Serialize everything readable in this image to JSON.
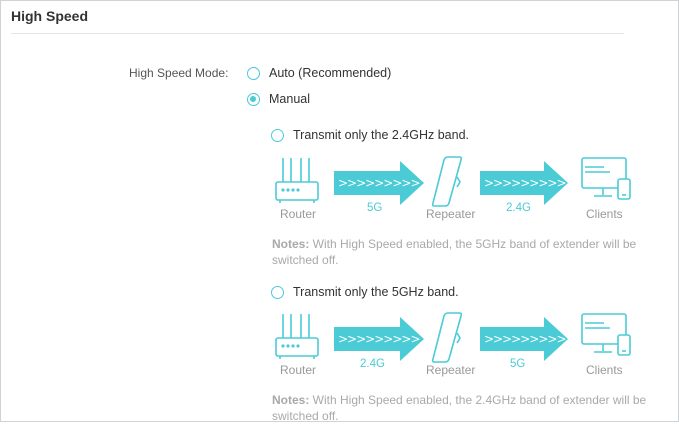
{
  "section": {
    "title": "High Speed"
  },
  "mode": {
    "label": "High Speed Mode:",
    "options": [
      {
        "label": "Auto (Recommended)",
        "selected": false
      },
      {
        "label": "Manual",
        "selected": true
      }
    ]
  },
  "manual_options": [
    {
      "label": "Transmit only the 2.4GHz band.",
      "selected": false,
      "diagram": {
        "router": "Router",
        "repeater": "Repeater",
        "clients": "Clients",
        "band_in": "5G",
        "band_out": "2.4G"
      },
      "notes_prefix": "Notes:",
      "notes_text": " With High Speed enabled, the 5GHz band of extender will be switched off."
    },
    {
      "label": "Transmit only the 5GHz band.",
      "selected": false,
      "diagram": {
        "router": "Router",
        "repeater": "Repeater",
        "clients": "Clients",
        "band_in": "2.4G",
        "band_out": "5G"
      },
      "notes_prefix": "Notes:",
      "notes_text": " With High Speed enabled, the 2.4GHz band of extender will be switched off."
    }
  ],
  "colors": {
    "accent": "#4acbd6",
    "muted_text": "#a9a9a9"
  }
}
